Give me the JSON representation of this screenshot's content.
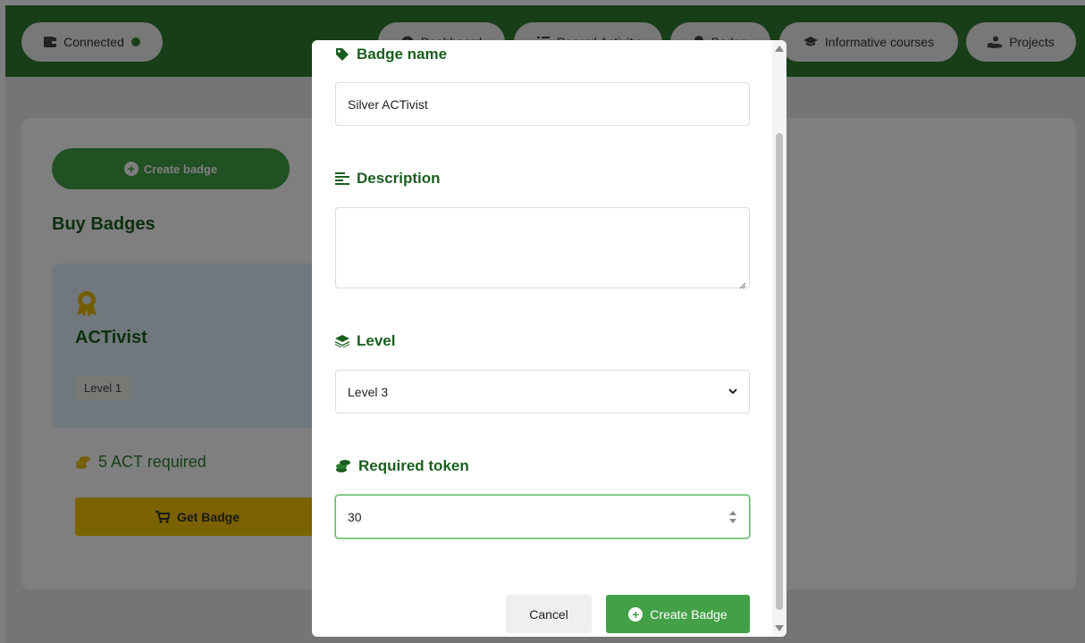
{
  "nav": {
    "connected_label": "Connected",
    "items": [
      {
        "label": "Dashboard",
        "icon": "dashboard-icon"
      },
      {
        "label": "Record Activity",
        "icon": "list-check-icon"
      },
      {
        "label": "Badge",
        "icon": "badge-icon"
      },
      {
        "label": "Informative courses",
        "icon": "graduation-cap-icon"
      },
      {
        "label": "Projects",
        "icon": "hand-holding-icon"
      }
    ]
  },
  "main": {
    "create_badge_label": "Create badge",
    "section_title": "Buy Badges",
    "badge_card": {
      "name": "ACTivist",
      "level": "Level 1",
      "requirement": "5 ACT required",
      "button_label": "Get Badge"
    }
  },
  "modal": {
    "badge_name_label": "Badge name",
    "badge_name_value": "Silver ACTivist",
    "description_label": "Description",
    "description_value": "",
    "level_label": "Level",
    "level_value": "Level 3",
    "token_label": "Required token",
    "token_value": "30",
    "cancel_label": "Cancel",
    "submit_label": "Create Badge"
  },
  "colors": {
    "brand_green": "#2e7d32",
    "button_green": "#43a047",
    "gold": "#f5c400",
    "badge_icon_gold": "#e6b800"
  }
}
